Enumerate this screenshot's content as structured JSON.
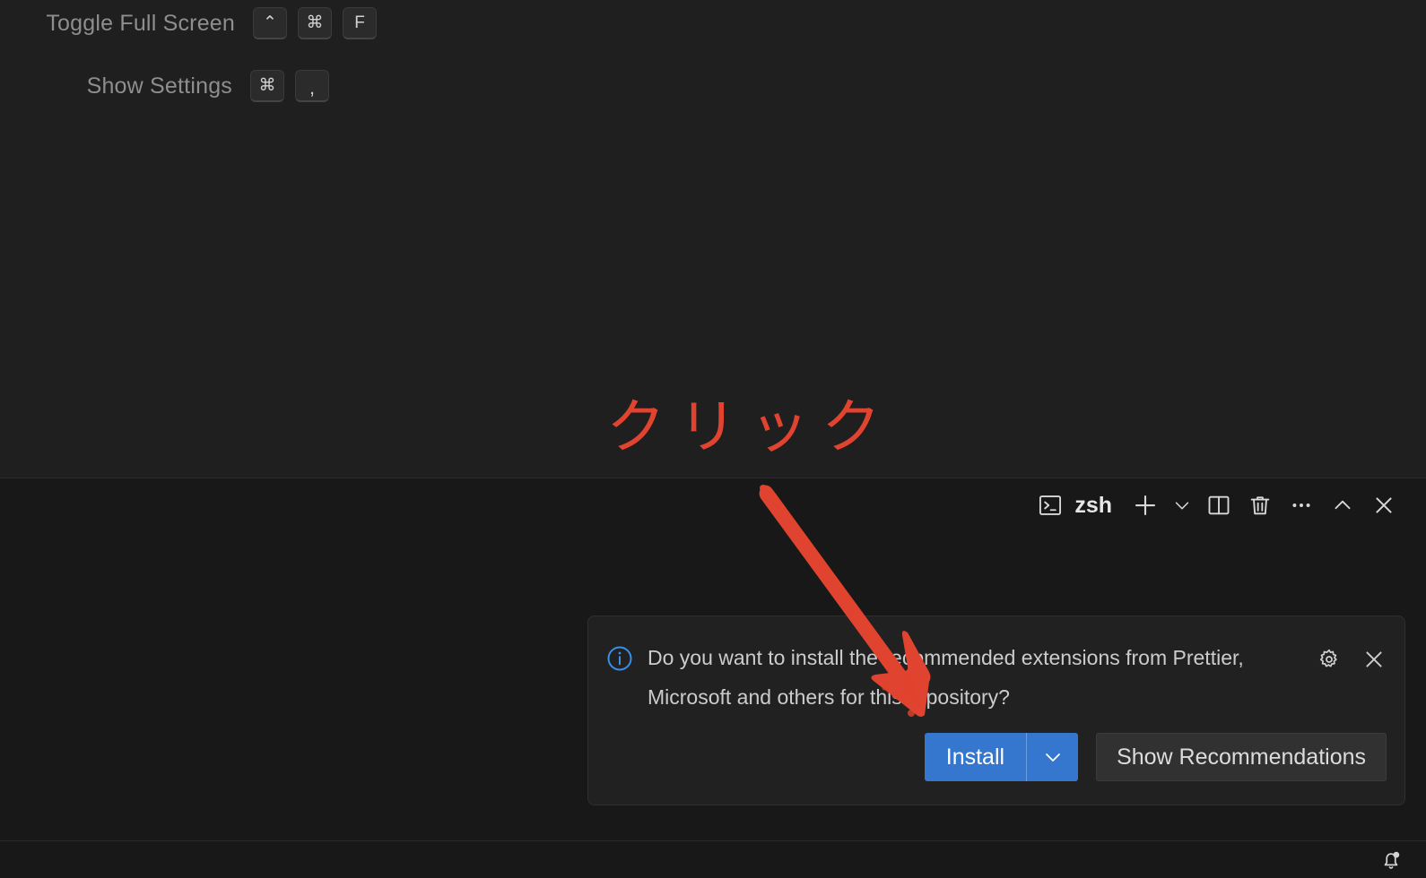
{
  "editor": {
    "keybindings": [
      {
        "name": "toggle-full-screen",
        "label": "Toggle Full Screen",
        "keys": [
          "⌃",
          "⌘",
          "F"
        ]
      },
      {
        "name": "show-settings",
        "label": "Show Settings",
        "keys": [
          "⌘",
          ","
        ]
      }
    ]
  },
  "annotation": {
    "text": "クリック",
    "color": "#e0432f"
  },
  "terminal": {
    "shell_label": "zsh",
    "toolbar": [
      {
        "name": "terminal-icon",
        "icon": "terminal-icon"
      },
      {
        "name": "new-terminal-button",
        "icon": "plus-icon"
      },
      {
        "name": "terminal-profile-dropdown",
        "icon": "chevron-down-icon"
      },
      {
        "name": "split-terminal-button",
        "icon": "split-icon"
      },
      {
        "name": "kill-terminal-button",
        "icon": "trash-icon"
      },
      {
        "name": "terminal-more-actions-button",
        "icon": "ellipsis-icon"
      },
      {
        "name": "panel-maximize-button",
        "icon": "chevron-up-icon"
      },
      {
        "name": "panel-close-button",
        "icon": "close-icon"
      }
    ]
  },
  "notification": {
    "severity_icon": "info-icon",
    "message": "Do you want to install the recommended extensions from Prettier, Microsoft and others for this repository?",
    "gear_icon": "gear-icon",
    "close_icon": "close-icon",
    "install_label": "Install",
    "install_dropdown_icon": "chevron-down-icon",
    "show_recommendations_label": "Show Recommendations",
    "accent_color": "#3576cf"
  },
  "status_bar": {
    "bell_icon": "bell-dot-icon"
  }
}
